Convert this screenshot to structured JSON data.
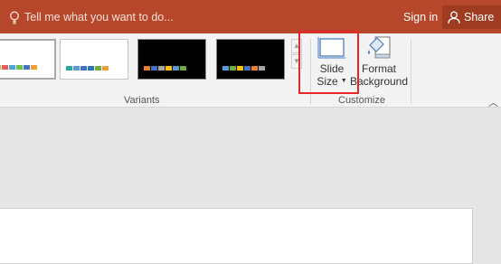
{
  "titlebar": {
    "tell_me": "Tell me what you want to do...",
    "sign_in": "Sign in",
    "share": "Share"
  },
  "ribbon": {
    "variants_label": "Variants",
    "customize_label": "Customize",
    "slide_size_line1": "Slide",
    "slide_size_line2": "Size",
    "format_bg_line1": "Format",
    "format_bg_line2": "Background"
  },
  "colors": {
    "titlebar": "#b7472a",
    "highlight": "#e8262a"
  },
  "variants": [
    {
      "style": "white",
      "swatches": [
        "#e8a33b",
        "#e35b5b",
        "#4aa7d8",
        "#6cc04a",
        "#4472c4",
        "#f0a030"
      ]
    },
    {
      "style": "white",
      "swatches": [
        "#2ba9a0",
        "#5b9bd5",
        "#4472c4",
        "#2e75b6",
        "#70ad47",
        "#f0a030"
      ]
    },
    {
      "style": "black",
      "swatches": [
        "#ed7d31",
        "#4472c4",
        "#a5a5a5",
        "#ffc000",
        "#5b9bd5",
        "#70ad47"
      ]
    },
    {
      "style": "black",
      "swatches": [
        "#5b9bd5",
        "#70ad47",
        "#ffc000",
        "#4472c4",
        "#ed7d31",
        "#a5a5a5"
      ]
    }
  ]
}
